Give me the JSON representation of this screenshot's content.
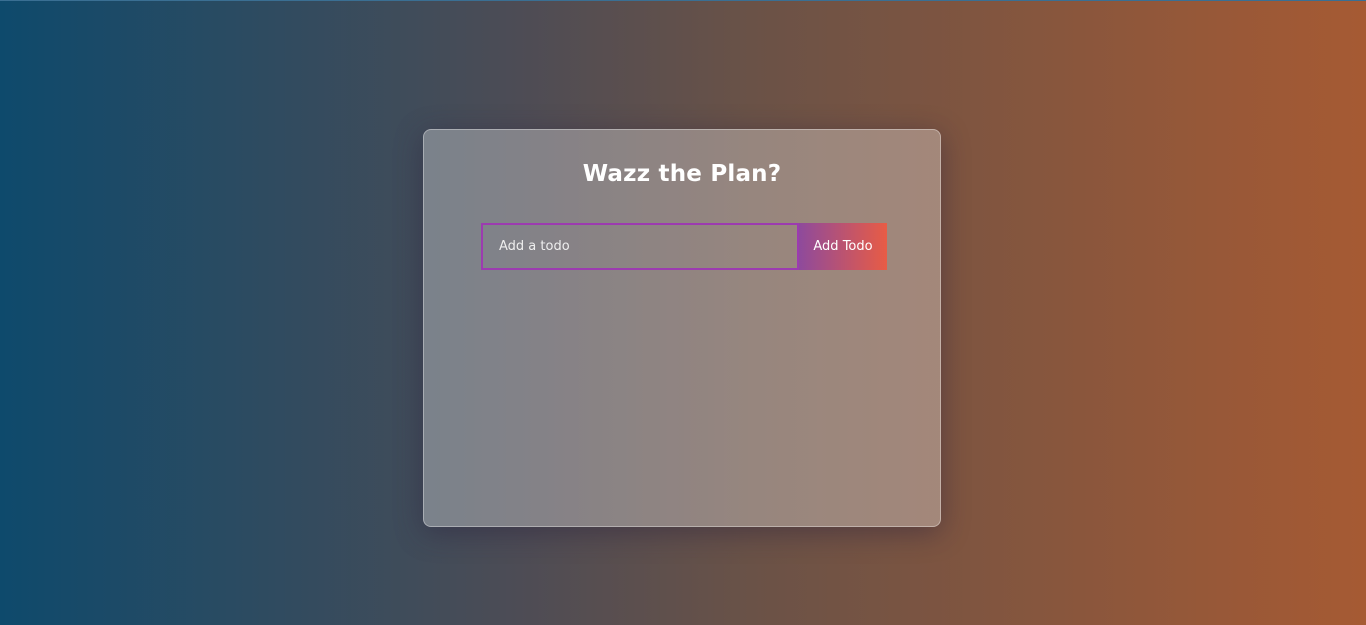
{
  "app": {
    "title": "Wazz the Plan?"
  },
  "form": {
    "input_value": "",
    "input_placeholder": "Add a todo",
    "add_button_label": "Add Todo"
  },
  "colors": {
    "background_left": "#0e4a6c",
    "background_right": "#a65a33",
    "input_border": "#9c3bb0",
    "button_gradient_start": "#8e4a9c",
    "button_gradient_end": "#e85c45"
  }
}
